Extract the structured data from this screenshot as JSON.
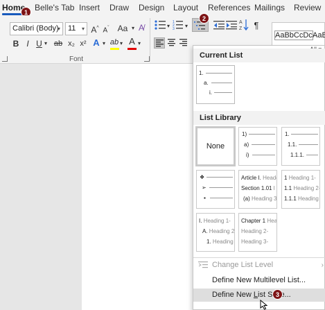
{
  "tabs": [
    "Home",
    "Belle's Tab",
    "Insert",
    "Draw",
    "Design",
    "Layout",
    "References",
    "Mailings",
    "Review"
  ],
  "badges": [
    "1",
    "2",
    "3"
  ],
  "font": {
    "name": "Calibri (Body)",
    "size": "11",
    "grow_label": "A^",
    "shrink_label": "Aˇ",
    "case_label": "Aa",
    "bold": "B",
    "italic": "I",
    "underline": "U",
    "strike": "ab",
    "subscript": "x₂",
    "superscript": "x²",
    "effects": "A",
    "highlight": "ab",
    "color": "A",
    "group_label": "Font"
  },
  "styles": {
    "normal": "AaBbCcDc",
    "no_spacing": "AaBb",
    "all_label": "All"
  },
  "panel": {
    "all_label": "All",
    "current_list_title": "Current List",
    "current_list": [
      "1.",
      "a.",
      "i."
    ],
    "list_library_title": "List Library",
    "thumbs": {
      "none": "None",
      "t2": [
        "1)",
        "a)",
        "i)"
      ],
      "t3": [
        "1.",
        "1.1.",
        "1.1.1."
      ],
      "t4": [
        "❖",
        "➢",
        "▪"
      ],
      "t5": [
        [
          "Article I.",
          "Heade"
        ],
        [
          "Section 1.01",
          "l"
        ],
        [
          "(a)",
          "Heading 3-"
        ]
      ],
      "t6": [
        [
          "1",
          "Heading 1-"
        ],
        [
          "1.1",
          "Heading 2-"
        ],
        [
          "1.1.1",
          "Heading 3-"
        ]
      ],
      "t7": [
        [
          "I.",
          "Heading 1-"
        ],
        [
          "A.",
          "Heading 2-"
        ],
        [
          "1.",
          "Heading"
        ]
      ],
      "t8": [
        [
          "Chapter 1",
          "Head"
        ],
        [
          "",
          "Heading 2-"
        ],
        [
          "",
          "Heading 3-"
        ]
      ]
    },
    "menu": {
      "change_level": "Change List Level",
      "define_multilevel": "Define New Multilevel List...",
      "define_style_pre": "Define New ",
      "define_style_u": "L",
      "define_style_post": "ist Style..."
    }
  },
  "colors": {
    "accent": "#185abd",
    "badge": "#7e1416",
    "highlight_bar": "#ffff00",
    "font_color_bar": "#e00000"
  }
}
